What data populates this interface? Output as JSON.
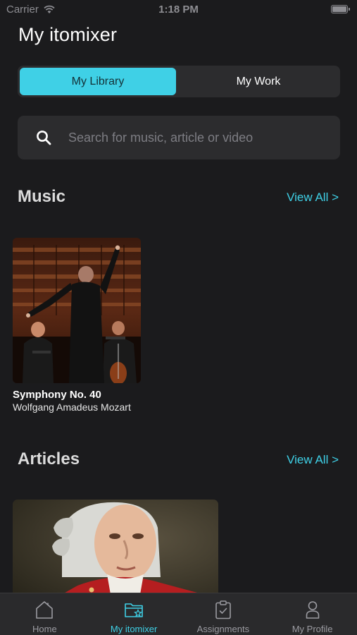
{
  "status_bar": {
    "carrier": "Carrier",
    "time": "1:18 PM"
  },
  "page": {
    "title": "My itomixer"
  },
  "segmented": {
    "left_label": "My Library",
    "right_label": "My Work",
    "selected": "My Library"
  },
  "search": {
    "placeholder": "Search for music, article or video",
    "value": ""
  },
  "music": {
    "title": "Music",
    "view_all": "View All >",
    "items": [
      {
        "title": "Symphony No. 40",
        "artist": "Wolfgang Amadeus Mozart"
      }
    ]
  },
  "articles": {
    "title": "Articles",
    "view_all": "View All >"
  },
  "tabs": [
    {
      "label": "Home",
      "icon": "home-icon"
    },
    {
      "label": "My itomixer",
      "icon": "folder-star-icon",
      "active": true
    },
    {
      "label": "Assignments",
      "icon": "clipboard-check-icon"
    },
    {
      "label": "My Profile",
      "icon": "person-icon"
    }
  ],
  "colors": {
    "accent": "#3fd0e6",
    "background": "#1b1b1d",
    "surface": "#2c2c2e"
  }
}
